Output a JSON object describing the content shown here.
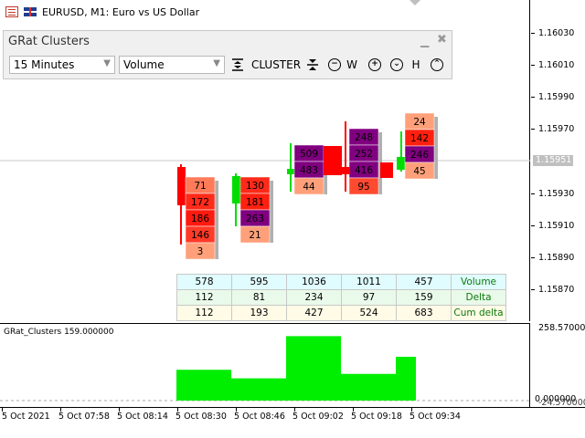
{
  "window": {
    "title": "EURUSD, M1:  Euro vs US Dollar"
  },
  "panel": {
    "title": "GRat Clusters",
    "minimize_glyph": "▁",
    "close_glyph": "✖",
    "period_dropdown": "15 Minutes",
    "type_dropdown": "Volume",
    "cluster_label": "CLUSTER",
    "w_label": "W",
    "h_label": "H"
  },
  "price_axis": {
    "labels": [
      "1.16030",
      "1.16010",
      "1.15990",
      "1.15970",
      "1.15930",
      "1.15910",
      "1.15890",
      "1.15870"
    ],
    "current_price": "1.15951"
  },
  "candles": [
    {
      "clusters": [
        {
          "value": "71",
          "color": "#ff7b5a"
        },
        {
          "value": "172",
          "color": "#ff2a1a"
        },
        {
          "value": "186",
          "color": "#ff1a10"
        },
        {
          "value": "146",
          "color": "#ff3a28"
        },
        {
          "value": "3",
          "color": "#ffa07a"
        }
      ]
    },
    {
      "clusters": [
        {
          "value": "130",
          "color": "#ff2a1a"
        },
        {
          "value": "181",
          "color": "#ff2010"
        },
        {
          "value": "263",
          "color": "#800080"
        },
        {
          "value": "21",
          "color": "#ffa07a"
        }
      ]
    },
    {
      "clusters": [
        {
          "value": "509",
          "color": "#800080"
        },
        {
          "value": "483",
          "color": "#800080"
        },
        {
          "value": "44",
          "color": "#ffa07a"
        }
      ]
    },
    {
      "clusters": [
        {
          "value": "248",
          "color": "#800080"
        },
        {
          "value": "252",
          "color": "#800080"
        },
        {
          "value": "416",
          "color": "#800080"
        },
        {
          "value": "95",
          "color": "#ff4a30"
        }
      ]
    },
    {
      "clusters": [
        {
          "value": "24",
          "color": "#ffa07a"
        },
        {
          "value": "142",
          "color": "#ff2010"
        },
        {
          "value": "246",
          "color": "#800080"
        },
        {
          "value": "45",
          "color": "#ffa07a"
        }
      ]
    }
  ],
  "stats": {
    "volume": [
      "578",
      "595",
      "1036",
      "1011",
      "457"
    ],
    "delta": [
      "112",
      "81",
      "234",
      "97",
      "159"
    ],
    "cum_delta": [
      "112",
      "193",
      "427",
      "524",
      "683"
    ],
    "volume_label": "Volume",
    "delta_label": "Delta",
    "cum_delta_label": "Cum delta"
  },
  "indicator": {
    "label": "GRat_Clusters 159.000000",
    "axis_top": "258.570000",
    "axis_bottom": "0.000000",
    "axis_overlap": "-24.570000",
    "values": [
      112,
      81,
      234,
      97,
      159
    ],
    "color": "#00ee00"
  },
  "time_axis": {
    "labels": [
      "5 Oct 2021",
      "5 Oct 07:58",
      "5 Oct 08:14",
      "5 Oct 08:30",
      "5 Oct 08:46",
      "5 Oct 09:02",
      "5 Oct 09:18",
      "5 Oct 09:34"
    ]
  },
  "colors": {
    "bull": "#00dd00",
    "bear": "#ff0000",
    "shadow": "#b0b0b0"
  }
}
